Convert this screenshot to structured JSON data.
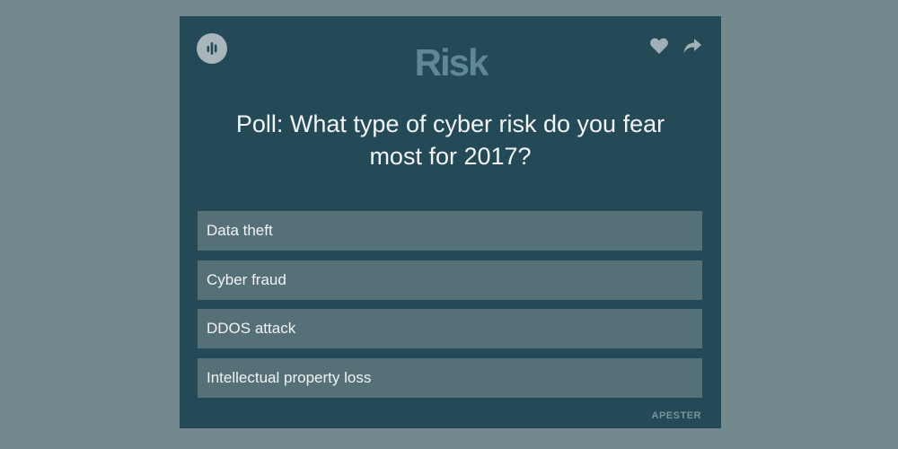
{
  "poll": {
    "logo_text": "Risk",
    "title": "Poll: What type of cyber risk do you fear most for 2017?",
    "answers": [
      {
        "label": "Data theft"
      },
      {
        "label": "Cyber fraud"
      },
      {
        "label": "DDOS attack"
      },
      {
        "label": "Intellectual property loss"
      }
    ],
    "brand_text": "APESTER"
  },
  "icons": {
    "results": "bar-chart-icon",
    "like": "heart-icon",
    "share": "share-arrow-icon"
  },
  "colors": {
    "page_background": "#74898e",
    "card_background": "#244a58",
    "answer_background": "#557077",
    "logo": "#5e8797",
    "text": "#f2f4f4"
  }
}
